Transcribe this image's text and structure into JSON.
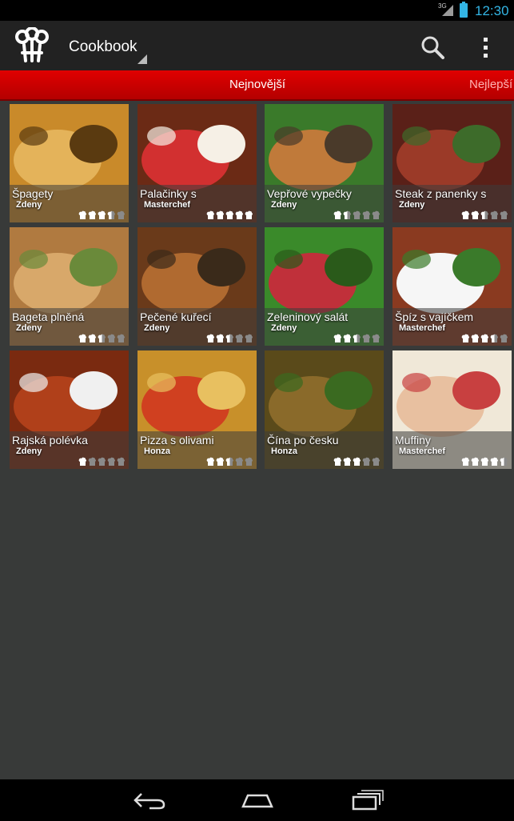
{
  "status_bar": {
    "network": "3G",
    "time": "12:30"
  },
  "action_bar": {
    "title": "Cookbook",
    "icons": [
      "chef-hat-logo-icon",
      "search-icon",
      "overflow-menu-icon"
    ]
  },
  "tabs": [
    {
      "label": "Nejnovější",
      "selected": true
    },
    {
      "label": "Nejlepší",
      "selected": false
    }
  ],
  "recipes": [
    {
      "title": "Špagety",
      "author": "Zdeny",
      "rating": 3.5
    },
    {
      "title": "Palačinky s",
      "author": "Masterchef",
      "rating": 5
    },
    {
      "title": "Vepřové vypečky",
      "author": "Zdeny",
      "rating": 1.5
    },
    {
      "title": "Steak z panenky s",
      "author": "Zdeny",
      "rating": 2.5
    },
    {
      "title": "Bageta plněná",
      "author": "Zdeny",
      "rating": 2.5
    },
    {
      "title": "Pečené kuřecí",
      "author": "Zdeny",
      "rating": 2.5
    },
    {
      "title": "Zeleninový salát",
      "author": "Zdeny",
      "rating": 2.5
    },
    {
      "title": "Špíz s vajíčkem",
      "author": "Masterchef",
      "rating": 3.5
    },
    {
      "title": "Rajská polévka",
      "author": "Zdeny",
      "rating": 1
    },
    {
      "title": "Pizza s olivami",
      "author": "Honza",
      "rating": 2.5
    },
    {
      "title": "Čína po česku",
      "author": "Honza",
      "rating": 3
    },
    {
      "title": "Muffiny",
      "author": "Masterchef",
      "rating": 4.5
    }
  ],
  "nav_bar": {
    "icons": [
      "back-icon",
      "home-icon",
      "recent-apps-icon"
    ]
  },
  "colors": {
    "tab_red": "#d40000",
    "accent_blue": "#33b5e5",
    "background": "#383a39"
  }
}
